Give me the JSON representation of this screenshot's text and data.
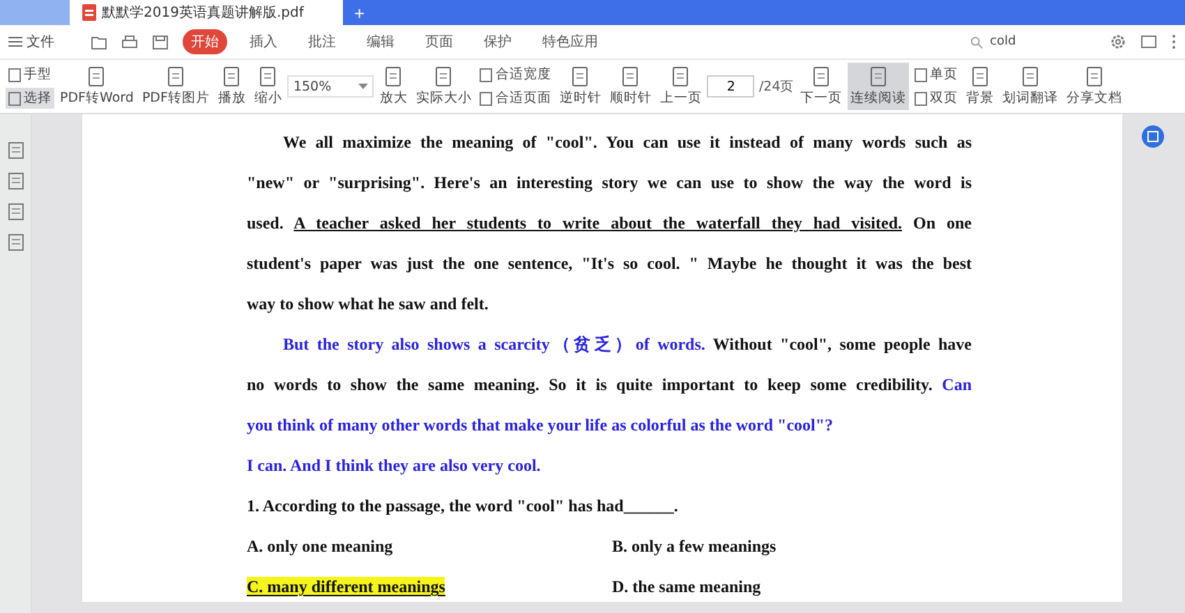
{
  "tab_bar": {
    "tabs": [
      {
        "title": "默默学2019英语真题讲解版.pdf",
        "selected": true
      }
    ],
    "new_tab": "+"
  },
  "menu_bar": {
    "file": "文件",
    "tabs": [
      {
        "label": "开始",
        "selected": true
      },
      {
        "label": "插入",
        "selected": false
      },
      {
        "label": "批注",
        "selected": false
      },
      {
        "label": "编辑",
        "selected": false
      },
      {
        "label": "页面",
        "selected": false
      },
      {
        "label": "保护",
        "selected": false
      },
      {
        "label": "特色应用",
        "selected": false
      }
    ],
    "search": {
      "value": "cold"
    }
  },
  "toolbar": [
    {
      "kind": "pair",
      "items": [
        {
          "label": "手型",
          "selected": false
        },
        {
          "label": "选择",
          "selected": true
        }
      ]
    },
    {
      "kind": "button",
      "label": "PDF转Word",
      "selected": false
    },
    {
      "kind": "button",
      "label": "PDF转图片",
      "selected": false
    },
    {
      "kind": "button",
      "label": "播放",
      "selected": false
    },
    {
      "kind": "button",
      "label": "缩小",
      "selected": false
    },
    {
      "kind": "zoom",
      "value": "150%"
    },
    {
      "kind": "button",
      "label": "放大",
      "selected": false
    },
    {
      "kind": "button",
      "label": "实际大小",
      "selected": false
    },
    {
      "kind": "pair",
      "items": [
        {
          "label": "合适宽度",
          "selected": false
        },
        {
          "label": "合适页面",
          "selected": false
        }
      ]
    },
    {
      "kind": "button",
      "label": "逆时针",
      "selected": false
    },
    {
      "kind": "button",
      "label": "顺时针",
      "selected": false
    },
    {
      "kind": "button",
      "label": "上一页",
      "selected": false
    },
    {
      "kind": "page",
      "value": "2",
      "total": "/24页"
    },
    {
      "kind": "button",
      "label": "下一页",
      "selected": false
    },
    {
      "kind": "button",
      "label": "连续阅读",
      "selected": true
    },
    {
      "kind": "pair",
      "items": [
        {
          "label": "单页",
          "selected": false
        },
        {
          "label": "双页",
          "selected": false
        }
      ]
    },
    {
      "kind": "button",
      "label": "背景",
      "selected": false
    },
    {
      "kind": "button",
      "label": "划词翻译",
      "selected": false
    },
    {
      "kind": "button",
      "label": "分享文档",
      "selected": false
    }
  ],
  "document": {
    "lines": [
      {
        "indent": true,
        "segments": [
          {
            "kind": "plain",
            "text": "We all maximize the meaning of \"cool\". You can use it instead of many words such as"
          }
        ]
      },
      {
        "indent": false,
        "segments": [
          {
            "kind": "plain",
            "text": "\"new\" or \"surprising\". Here's an interesting story we can use to show the way the word is"
          }
        ]
      },
      {
        "indent": false,
        "segments": [
          {
            "kind": "plain",
            "text": "used. "
          },
          {
            "kind": "underline",
            "text": "A teacher asked her students to write about the waterfall they had visited."
          },
          {
            "kind": "plain",
            "text": " On one"
          }
        ]
      },
      {
        "indent": false,
        "segments": [
          {
            "kind": "plain",
            "text": "student's paper was just the one sentence, \"It's so cool. \" Maybe he thought it was the best"
          }
        ]
      },
      {
        "indent": false,
        "segments": [
          {
            "kind": "plain",
            "text": "way to show what he saw and felt."
          }
        ]
      },
      {
        "indent": true,
        "segments": [
          {
            "kind": "blue",
            "text": "But the story also shows a scarcity（贫乏）of words."
          },
          {
            "kind": "plain",
            "text": " Without \"cool\", some people have"
          }
        ]
      },
      {
        "indent": false,
        "segments": [
          {
            "kind": "plain",
            "text": "no words to show the same meaning. So it is quite important to keep some credibility. "
          },
          {
            "kind": "blue",
            "text": "Can"
          }
        ]
      },
      {
        "indent": false,
        "segments": [
          {
            "kind": "blue",
            "text": "you think of many other words that make your life as colorful as the word \"cool\"?"
          }
        ]
      },
      {
        "indent": false,
        "segments": [
          {
            "kind": "blue",
            "text": "I can. And I think they are also very cool."
          }
        ]
      }
    ],
    "question": "1. According to the passage, the word \"cool\" has had______.",
    "options": [
      {
        "text": "A. only one meaning",
        "selected": false
      },
      {
        "text": "B. only a few meanings",
        "selected": false
      },
      {
        "text": "C. many different meanings",
        "selected": true
      },
      {
        "text": "D. the same meaning",
        "selected": false
      }
    ]
  }
}
